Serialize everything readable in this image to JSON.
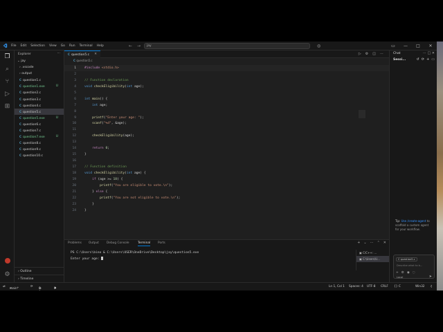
{
  "titlebar": {
    "menu": [
      "File",
      "Edit",
      "Selection",
      "View",
      "Go",
      "Run",
      "Terminal",
      "Help"
    ],
    "search_text": "jay"
  },
  "sidebar": {
    "title": "Explorer",
    "root": "jay",
    "items": [
      {
        "label": ".vscode",
        "type": "folder",
        "badge": ""
      },
      {
        "label": "output",
        "type": "folder",
        "badge": ""
      },
      {
        "label": "question1.c",
        "type": "c",
        "badge": ""
      },
      {
        "label": "question1.exe",
        "type": "exe",
        "badge": "U"
      },
      {
        "label": "question2.c",
        "type": "c",
        "badge": ""
      },
      {
        "label": "question3.c",
        "type": "c",
        "badge": ""
      },
      {
        "label": "question4.c",
        "type": "c",
        "badge": ""
      },
      {
        "label": "question5.c",
        "type": "c",
        "badge": ""
      },
      {
        "label": "question5.exe",
        "type": "exe",
        "badge": "U"
      },
      {
        "label": "question6.c",
        "type": "c",
        "badge": ""
      },
      {
        "label": "question7.c",
        "type": "c",
        "badge": ""
      },
      {
        "label": "question7.exe",
        "type": "exe",
        "badge": "U"
      },
      {
        "label": "question8.c",
        "type": "c",
        "badge": ""
      },
      {
        "label": "question9.c",
        "type": "c",
        "badge": ""
      },
      {
        "label": "question10.c",
        "type": "c",
        "badge": ""
      }
    ],
    "outline": "Outline",
    "timeline": "Timeline"
  },
  "editor": {
    "tab": "question5.c",
    "breadcrumb": "question5.c",
    "lines": [
      "#include <stdio.h>",
      "",
      "// Function declaration",
      "void checkEligibility(int age);",
      "",
      "int main() {",
      "    int age;",
      "",
      "    printf(\"Enter your age: \");",
      "    scanf(\"%d\", &age);",
      "",
      "    checkEligibility(age);",
      "",
      "    return 0;",
      "}",
      "",
      "// Function definition",
      "void checkEligibility(int age) {",
      "    if (age >= 18) {",
      "        printf(\"You are eligible to vote.\\n\");",
      "    } else {",
      "        printf(\"You are not eligible to vote.\\n\");",
      "    }",
      "}"
    ]
  },
  "panel": {
    "tabs": [
      "Problems",
      "Output",
      "Debug Console",
      "Terminal",
      "Ports"
    ],
    "active_tab": "Terminal",
    "terminal_lines": [
      "PS C:\\Users\\bino & C:\\Users\\USER\\OneDrive\\Desktop\\jay\\question5.exe",
      "Enter your age: "
    ],
    "terminals": [
      "C/C++: ...",
      "C:\\Users\\U..."
    ]
  },
  "chat": {
    "title": "Chat",
    "session": "Sessi...",
    "tip_prefix": "Tip:",
    "tip_link": "Use /create-agent",
    "tip_rest": "to scaffold a custom agent for your workflow.",
    "chip": "question5.c",
    "placeholder": "Describe what to b...",
    "mode": "Local"
  },
  "statusbar": {
    "left": [
      "main*",
      "0 0",
      "0"
    ],
    "position": "Ln 1, Col 1",
    "spaces": "Spaces: 4",
    "encoding": "UTF-8",
    "eol": "CRLF",
    "lang": "{} C",
    "platform": "Win32"
  },
  "colors": {
    "accent": "#0078d4",
    "background": "#1f1f1f",
    "sidebar": "#181818"
  }
}
